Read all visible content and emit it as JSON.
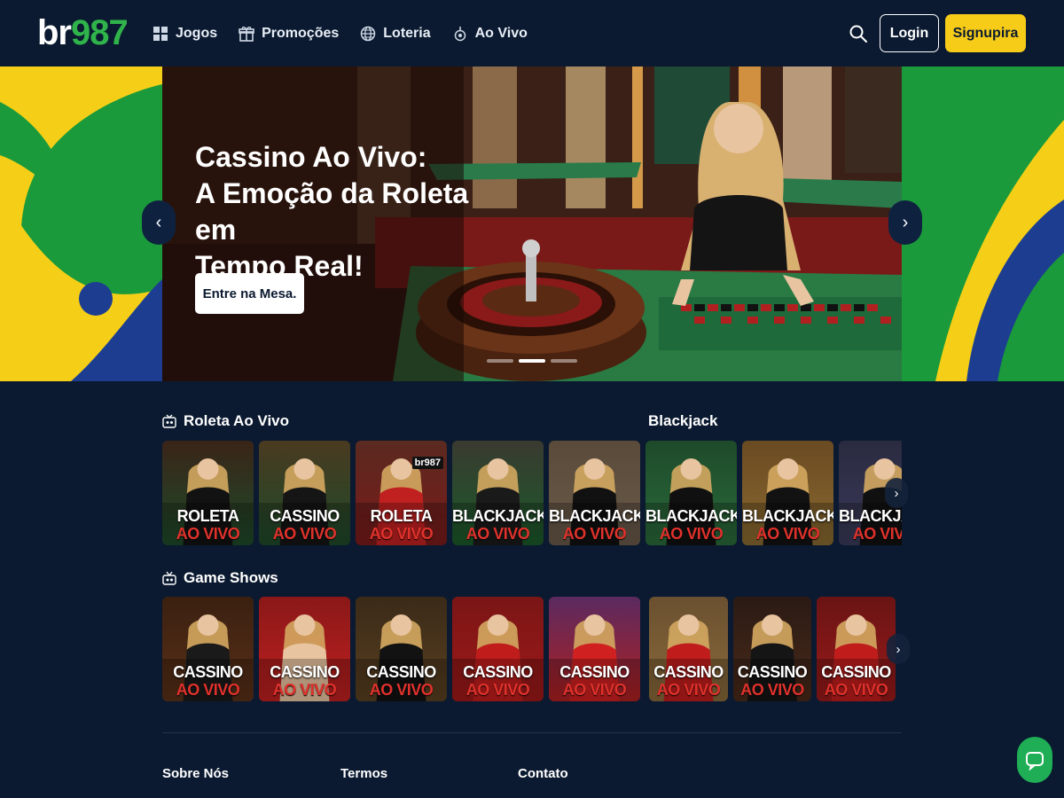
{
  "header": {
    "logo_part1": "br",
    "logo_part2": "987",
    "nav": [
      {
        "label": "Jogos",
        "icon": "grid-icon"
      },
      {
        "label": "Promoções",
        "icon": "gift-icon"
      },
      {
        "label": "Loteria",
        "icon": "globe-icon"
      },
      {
        "label": "Ao Vivo",
        "icon": "live-icon"
      }
    ],
    "login_label": "Login",
    "signup_label": "Signupira"
  },
  "hero": {
    "title_lines": [
      "Cassino Ao Vivo:",
      "A Emoção da Roleta em",
      "Tempo Real!"
    ],
    "cta_label": "Entre na Mesa.",
    "slides_total": 3,
    "active_slide": 2
  },
  "sections": {
    "roleta": {
      "title": "Roleta Ao Vivo",
      "secondary_title": "Blackjack",
      "cards": [
        {
          "line1": "ROLETA",
          "line2": "AO VIVO"
        },
        {
          "line1": "CASSINO",
          "line2": "AO VIVO"
        },
        {
          "line1": "ROLETA",
          "line2": "AO VIVO",
          "badge": "br987"
        },
        {
          "line1": "BLACKJACK",
          "line2": "AO VIVO"
        },
        {
          "line1": "BLACKJACK",
          "line2": "AO VIVO"
        },
        {
          "line1": "BLACKJACK",
          "line2": "AO VIVO"
        },
        {
          "line1": "BLACKJACK",
          "line2": "AO VIVO"
        },
        {
          "line1": "BLACKJACK",
          "line2": "AO VIVO"
        }
      ]
    },
    "gameshows": {
      "title": "Game Shows",
      "cards": [
        {
          "line1": "CASSINO",
          "line2": "AO VIVO"
        },
        {
          "line1": "CASSINO",
          "line2": "AO VIVO"
        },
        {
          "line1": "CASSINO",
          "line2": "AO VIVO"
        },
        {
          "line1": "CASSINO",
          "line2": "AO VIVO"
        },
        {
          "line1": "CASSINO",
          "line2": "AO VIVO"
        },
        {
          "line1": "CASSINO",
          "line2": "AO VIVO"
        },
        {
          "line1": "CASSINO",
          "line2": "AO VIVO"
        },
        {
          "line1": "CASSINO",
          "line2": "AO VIVO"
        }
      ]
    }
  },
  "footer": {
    "columns": [
      "Sobre Nós",
      "Termos",
      "Contato"
    ]
  },
  "colors": {
    "background": "#0b1a30",
    "accent_yellow": "#f6cc19",
    "logo_green": "#2fb34a",
    "live_red": "#e0322c",
    "brazil_green": "#1a9a3a",
    "brazil_yellow": "#f5cf17",
    "brazil_blue": "#1d3d91"
  }
}
